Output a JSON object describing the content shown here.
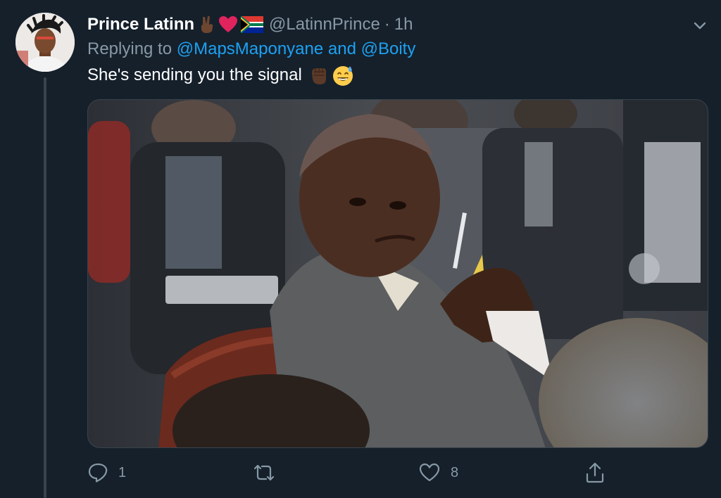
{
  "tweet": {
    "author_name": "Prince Latinn",
    "author_handle": "@LatinnPrince",
    "separator": "·",
    "time": "1h",
    "replying_prefix": "Replying to",
    "replying_mention_1": "@MapsMaponyane",
    "replying_and": "and",
    "replying_mention_2": "@Boity",
    "text": "She's sending you the signal",
    "name_emojis": [
      "victory-hand-dark-skin",
      "red-heart",
      "south-africa-flag"
    ],
    "text_emojis": [
      "raised-fist-dark-skin",
      "grinning-face-with-sweat"
    ]
  },
  "actions": {
    "reply_count": "1",
    "retweet_count": "",
    "like_count": "8"
  },
  "colors": {
    "background": "#15202b",
    "secondary_text": "#8899a6",
    "link": "#1da1f2",
    "border": "#38444d"
  },
  "media": {
    "description_icon": "photo"
  }
}
